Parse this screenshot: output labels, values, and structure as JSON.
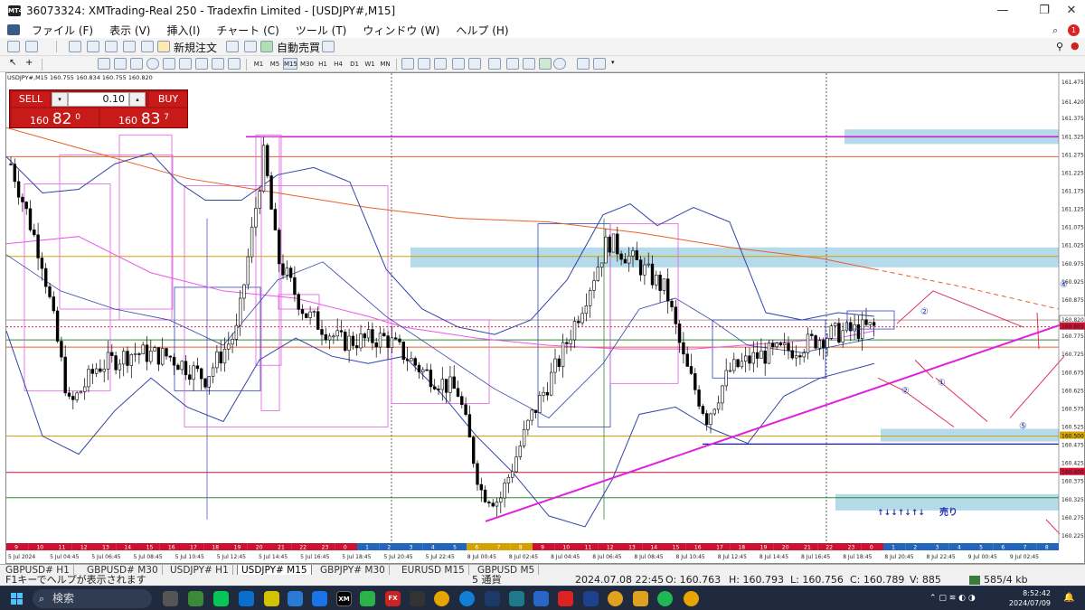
{
  "window": {
    "title": "36073324: XMTrading-Real 250 - Tradexfin Limited - [USDJPY#,M15]",
    "app_icon": "MT4",
    "minimize_icon": "minimize-icon",
    "maximize_icon": "restore-icon",
    "close_icon": "close-icon"
  },
  "menu": [
    "ファイル (F)",
    "表示 (V)",
    "挿入(I)",
    "チャート (C)",
    "ツール (T)",
    "ウィンドウ (W)",
    "ヘルプ (H)"
  ],
  "toolbar": {
    "new_order": "新規注文",
    "auto_trading": "自動売買",
    "timeframes": [
      "M1",
      "M5",
      "M15",
      "M30",
      "H1",
      "H4",
      "D1",
      "W1",
      "MN"
    ],
    "active_timeframe": "M15"
  },
  "chart": {
    "header": "USDJPY#,M15  160.755 160.834 160.755 160.820",
    "price_labels": [
      "161.475",
      "161.420",
      "161.375",
      "161.325",
      "161.275",
      "161.225",
      "161.175",
      "161.125",
      "161.075",
      "161.025",
      "160.975",
      "160.925",
      "160.875",
      "160.820",
      "160.801",
      "160.775",
      "160.725",
      "160.675",
      "160.625",
      "160.575",
      "160.525",
      "160.500",
      "160.475",
      "160.425",
      "160.400",
      "160.375",
      "160.325",
      "160.275",
      "160.225"
    ],
    "highlight_prices": {
      "current": "160.820",
      "bid_line": "160.801",
      "level_161": "161.000",
      "level_160_500": "160.500",
      "level_160_400": "160.400"
    },
    "time_labels": [
      "5 Jul 2024",
      "5 Jul 04:45",
      "5 Jul 06:45",
      "5 Jul 08:45",
      "5 Jul 10:45",
      "5 Jul 12:45",
      "5 Jul 14:45",
      "5 Jul 16:45",
      "5 Jul 18:45",
      "5 Jul 20:45",
      "5 Jul 22:45",
      "8 Jul 00:45",
      "8 Jul 02:45",
      "8 Jul 04:45",
      "8 Jul 06:45",
      "8 Jul 08:45",
      "8 Jul 10:45",
      "8 Jul 12:45",
      "8 Jul 14:45",
      "8 Jul 16:45",
      "8 Jul 18:45",
      "8 Jul 20:45",
      "8 Jul 22:45",
      "9 Jul 00:45",
      "9 Jul 02:45"
    ],
    "hour_strip": [
      "9",
      "10",
      "11",
      "12",
      "13",
      "14",
      "15",
      "16",
      "17",
      "18",
      "19",
      "20",
      "21",
      "22",
      "23",
      "0",
      "1",
      "2",
      "3",
      "4",
      "5",
      "6",
      "7",
      "8",
      "9",
      "10",
      "11",
      "12",
      "13",
      "14",
      "15",
      "16",
      "17",
      "18",
      "19",
      "20",
      "21",
      "22",
      "23",
      "0",
      "1",
      "2",
      "3",
      "4",
      "5",
      "6",
      "7",
      "8"
    ],
    "annotations": {
      "circle2a": "②",
      "circle2b": "②",
      "circle1": "①",
      "circle5": "⑤",
      "circle4": "④",
      "arrows_text": "↑↓↓↑↓↑↓",
      "sell_text": "売り"
    },
    "colors": {
      "magenta": "#e03ce0",
      "orange": "#e8602a",
      "gold": "#d4a100",
      "green": "#2e8b2e",
      "navy": "#1a1aa0",
      "red": "#cc1133",
      "zone": "#a8d4e6",
      "bull": "#ffffff",
      "bear": "#000000"
    }
  },
  "trade_panel": {
    "sell_label": "SELL",
    "buy_label": "BUY",
    "lot": "0.10",
    "sell_price_prefix": "160",
    "sell_price_big": "82",
    "sell_price_sup": "0",
    "buy_price_prefix": "160",
    "buy_price_big": "83",
    "buy_price_sup": "7",
    "spin_down": "▾",
    "spin_up": "▴"
  },
  "tabs": [
    "GBPUSD# H1",
    "GBPUSD# M30",
    "USDJPY# H1",
    "USDJPY# M15",
    "GBPJPY# M30",
    "EURUSD M15",
    "GBPUSD M5"
  ],
  "active_tab": "USDJPY# M15",
  "status": {
    "help": "F1キーでヘルプが表示されます",
    "profile": "5 通貨",
    "datetime": "2024.07.08 22:45",
    "open": "O: 160.763",
    "high": "H: 160.793",
    "low": "L: 160.756",
    "close": "C: 160.789",
    "volume": "V: 885",
    "traffic": "585/4 kb"
  },
  "taskbar": {
    "search_placeholder": "検索",
    "time": "8:52:42",
    "date": "2024/07/09",
    "apps": [
      "XM",
      "FX"
    ]
  }
}
